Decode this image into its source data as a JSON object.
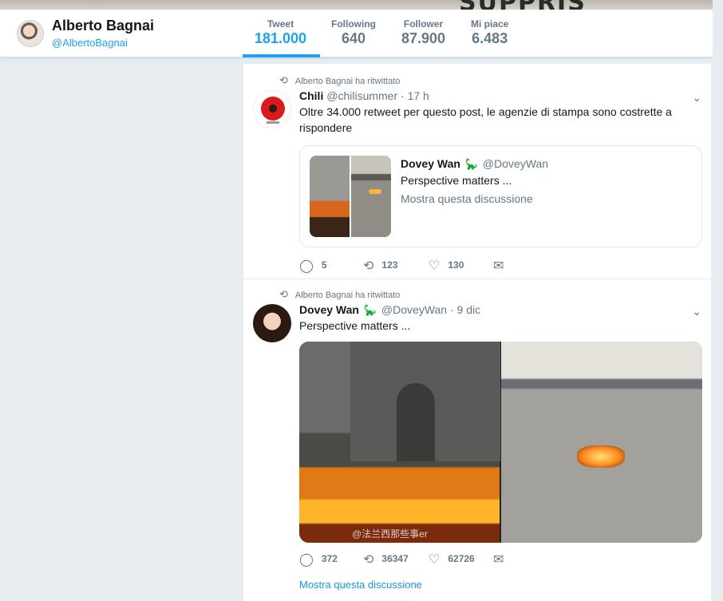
{
  "banner": {
    "partial_text": "SUPPRIS"
  },
  "profile": {
    "name": "Alberto Bagnai",
    "handle": "@AlbertoBagnai"
  },
  "stats": [
    {
      "label": "Tweet",
      "value": "181.000",
      "active": true
    },
    {
      "label": "Following",
      "value": "640"
    },
    {
      "label": "Follower",
      "value": "87.900"
    },
    {
      "label": "Mi piace",
      "value": "6.483"
    }
  ],
  "tweets": [
    {
      "context": "Alberto Bagnai ha ritwittato",
      "author": "Chili",
      "handle": "@chilisummer",
      "time": "· 17 h",
      "text": "Oltre 34.000 retweet per questo post, le agenzie di stampa sono costrette a rispondere",
      "quote": {
        "author": "Dovey Wan",
        "emoji": "🦕",
        "handle": "@DoveyWan",
        "text": "Perspective matters ...",
        "link": "Mostra questa discussione"
      },
      "actions": {
        "replies": "5",
        "retweets": "123",
        "likes": "130"
      }
    },
    {
      "context": "Alberto Bagnai ha ritwittato",
      "author": "Dovey Wan",
      "emoji": "🦕",
      "handle": "@DoveyWan",
      "time": "· 9 dic",
      "text": "Perspective matters ...",
      "media_watermark": "@法兰西那些事er",
      "actions": {
        "replies": "372",
        "retweets": "36347",
        "likes": "62726"
      },
      "thread_link": "Mostra questa discussione"
    }
  ],
  "icons": {
    "retweet_context": "retweet-icon",
    "reply": "reply-icon",
    "retweet": "retweet-icon",
    "like": "heart-icon",
    "dm": "envelope-icon",
    "caret": "chevron-down-icon"
  },
  "colors": {
    "accent": "#1da1f2",
    "link": "#1b95e0",
    "muted": "#657786",
    "background": "#e6ecf0"
  }
}
